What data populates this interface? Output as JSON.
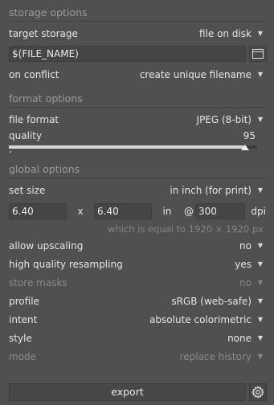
{
  "storage": {
    "header": "storage options",
    "target_label": "target storage",
    "target_value": "file on disk",
    "filename": "$(FILE_NAME)",
    "conflict_label": "on conflict",
    "conflict_value": "create unique filename"
  },
  "format": {
    "header": "format options",
    "file_format_label": "file format",
    "file_format_value": "JPEG (8-bit)",
    "quality_label": "quality",
    "quality_value": "95",
    "quality_fraction": 0.95
  },
  "global": {
    "header": "global options",
    "set_size_label": "set size",
    "set_size_value": "in inch (for print)",
    "width": "6.40",
    "x_sep": "x",
    "height": "6.40",
    "unit": "in",
    "at_sep": "@",
    "dpi_value": "300",
    "dpi_label": "dpi",
    "size_hint": "which is equal to 1920 × 1920 px",
    "upscaling_label": "allow upscaling",
    "upscaling_value": "no",
    "hq_label": "high quality resampling",
    "hq_value": "yes",
    "masks_label": "store masks",
    "masks_value": "no",
    "profile_label": "profile",
    "profile_value": "sRGB (web-safe)",
    "intent_label": "intent",
    "intent_value": "absolute colorimetric",
    "style_label": "style",
    "style_value": "none",
    "mode_label": "mode",
    "mode_value": "replace history"
  },
  "actions": {
    "export_label": "export"
  },
  "icons": {
    "caret": "caret-down-icon",
    "folder": "folder-icon",
    "gear": "gear-icon"
  }
}
